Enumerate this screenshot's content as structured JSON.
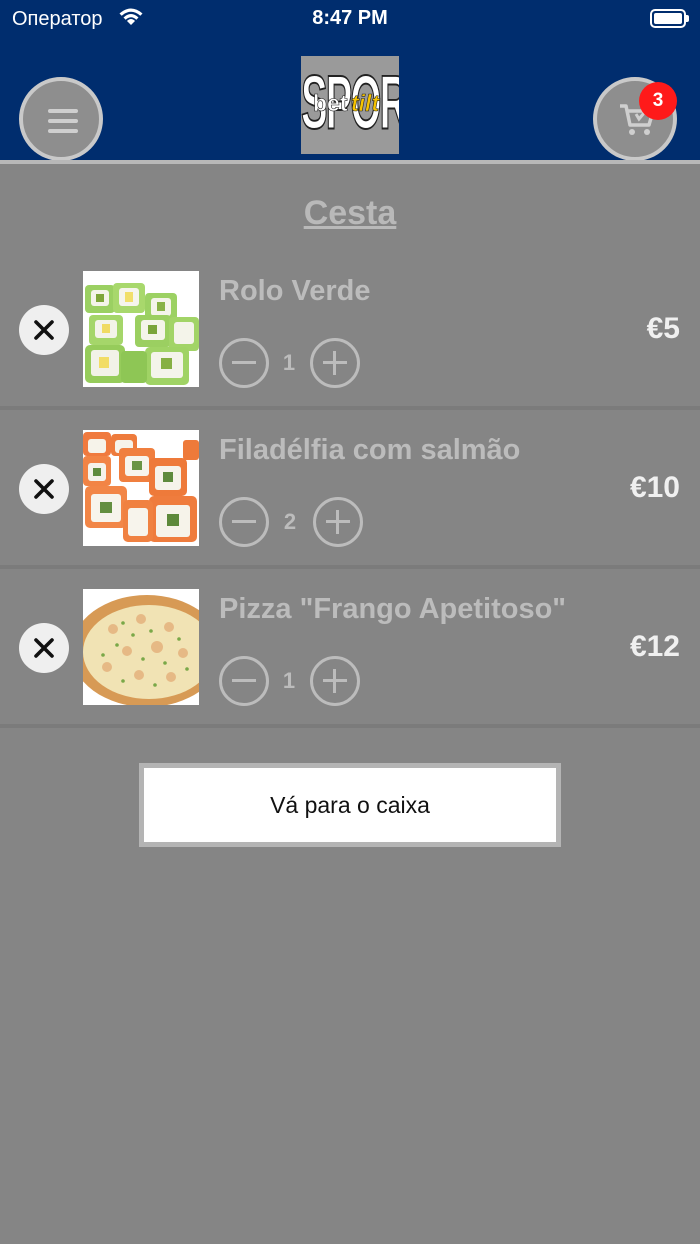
{
  "status_bar": {
    "carrier": "Оператор",
    "time": "8:47 PM"
  },
  "header": {
    "cart_badge": "3"
  },
  "page": {
    "title": "Cesta"
  },
  "cart_items": [
    {
      "name": "Rolo Verde",
      "quantity": "1",
      "price": "€5"
    },
    {
      "name": "Filadélfia com salmão",
      "quantity": "2",
      "price": "€10"
    },
    {
      "name": "Pizza \"Frango Apetitoso\"",
      "quantity": "1",
      "price": "€12"
    }
  ],
  "checkout": {
    "label": "Vá para o caixa"
  },
  "logo": {
    "word": "SPORTS",
    "bet": "bet",
    "tilt": "tilt"
  },
  "colors": {
    "header_bg": "#002d6e",
    "background": "#858585",
    "badge": "#ff1a1a"
  },
  "icons": {
    "menu": "hamburger-icon",
    "cart": "cart-icon",
    "remove": "close-icon",
    "minus": "minus-circle-icon",
    "plus": "plus-circle-icon"
  }
}
